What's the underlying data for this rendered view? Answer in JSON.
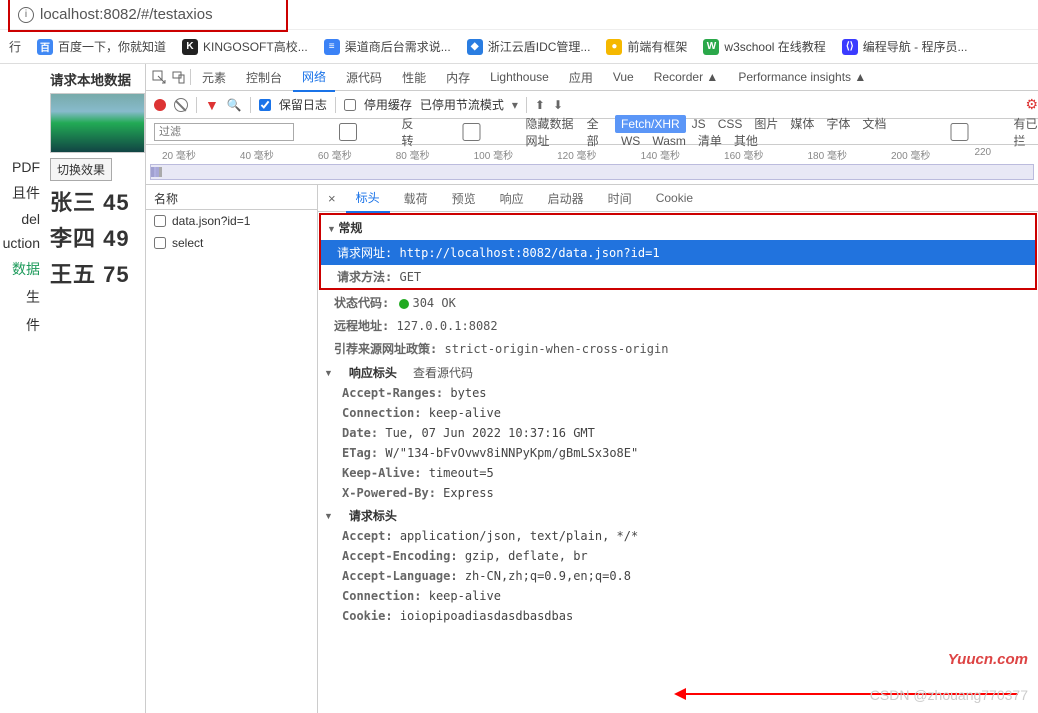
{
  "url": "localhost:8082/#/testaxios",
  "bookmarks": [
    {
      "label": "行",
      "icon": "",
      "bg": ""
    },
    {
      "label": "百度一下，你就知道",
      "bg": "#4088f4",
      "icon": "百"
    },
    {
      "label": "KINGOSOFT高校...",
      "bg": "#222",
      "icon": "K"
    },
    {
      "label": "渠道商后台需求说...",
      "bg": "#3b82f6",
      "icon": "≡"
    },
    {
      "label": "浙江云盾IDC管理...",
      "bg": "#2a7de1",
      "icon": "◆"
    },
    {
      "label": "前端有框架",
      "bg": "#f5b800",
      "icon": "●"
    },
    {
      "label": "w3school 在线教程",
      "bg": "#2ba84a",
      "icon": "W"
    },
    {
      "label": "编程导航 - 程序员...",
      "bg": "#3b3bff",
      "icon": "⟨⟩"
    }
  ],
  "leftmenu": {
    "items": [
      "PDF",
      "且件",
      "del",
      "uction",
      "数据",
      "生",
      "件"
    ],
    "activeIndex": 4
  },
  "page": {
    "title": "请求本地数据",
    "button": "切换效果",
    "rows": [
      {
        "name": "张三",
        "val": "45"
      },
      {
        "name": "李四",
        "val": "49"
      },
      {
        "name": "王五",
        "val": "75"
      }
    ]
  },
  "devtools": {
    "tabs": [
      "元素",
      "控制台",
      "网络",
      "源代码",
      "性能",
      "内存",
      "Lighthouse",
      "应用",
      "Vue",
      "Recorder ▲",
      "Performance insights ▲"
    ],
    "activeTab": 2,
    "toolbar": {
      "preserveLog": "保留日志",
      "disableCache": "停用缓存",
      "throttling": "已停用节流模式"
    },
    "filterRow": {
      "placeholder": "过滤",
      "invert": "反转",
      "hideData": "隐藏数据网址",
      "all": "全部",
      "types": [
        "Fetch/XHR",
        "JS",
        "CSS",
        "图片",
        "媒体",
        "字体",
        "文档",
        "WS",
        "Wasm",
        "清单",
        "其他"
      ],
      "blocked": "有已拦"
    },
    "timeline": [
      "20 毫秒",
      "40 毫秒",
      "60 毫秒",
      "80 毫秒",
      "100 毫秒",
      "120 毫秒",
      "140 毫秒",
      "160 毫秒",
      "180 毫秒",
      "200 毫秒",
      "220"
    ],
    "reqlist": {
      "header": "名称",
      "items": [
        "data.json?id=1",
        "select"
      ]
    },
    "detailTabs": [
      "标头",
      "载荷",
      "预览",
      "响应",
      "启动器",
      "时间",
      "Cookie"
    ],
    "detailActive": 0,
    "general": {
      "title": "常规",
      "url_k": "请求网址:",
      "url_v": "http://localhost:8082/data.json?id=1",
      "method_k": "请求方法:",
      "method_v": "GET",
      "status_k": "状态代码:",
      "status_v": "304 OK",
      "remote_k": "远程地址:",
      "remote_v": "127.0.0.1:8082",
      "policy_k": "引荐来源网址政策:",
      "policy_v": "strict-origin-when-cross-origin"
    },
    "respHeaders": {
      "title": "响应标头",
      "viewSource": "查看源代码",
      "rows": [
        {
          "k": "Accept-Ranges:",
          "v": "bytes"
        },
        {
          "k": "Connection:",
          "v": "keep-alive"
        },
        {
          "k": "Date:",
          "v": "Tue, 07 Jun 2022 10:37:16 GMT"
        },
        {
          "k": "ETag:",
          "v": "W/\"134-bFvOvwv8iNNPyKpm/gBmLSx3o8E\""
        },
        {
          "k": "Keep-Alive:",
          "v": "timeout=5"
        },
        {
          "k": "X-Powered-By:",
          "v": "Express"
        }
      ]
    },
    "reqHeaders": {
      "title": "请求标头",
      "rows": [
        {
          "k": "Accept:",
          "v": "application/json, text/plain, */*"
        },
        {
          "k": "Accept-Encoding:",
          "v": "gzip, deflate, br"
        },
        {
          "k": "Accept-Language:",
          "v": "zh-CN,zh;q=0.9,en;q=0.8"
        },
        {
          "k": "Connection:",
          "v": "keep-alive"
        },
        {
          "k": "Cookie:",
          "v": "ioiopipoadiasdasdbasdbas"
        }
      ]
    }
  },
  "watermark1": "Yuucn.com",
  "watermark2": "CSDN @zhouang770377"
}
